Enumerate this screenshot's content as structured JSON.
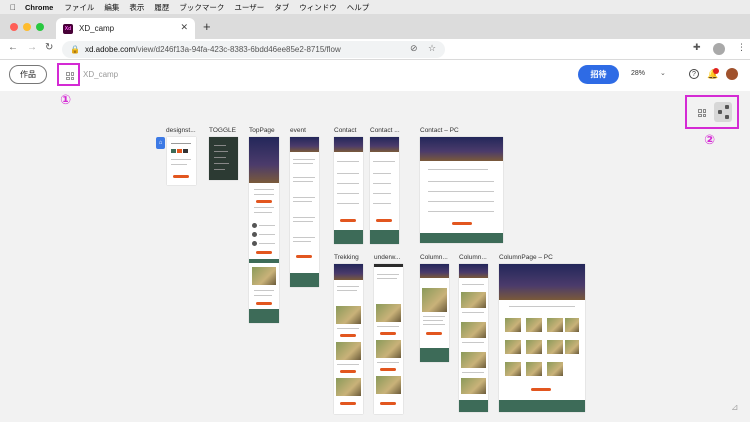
{
  "menubar": {
    "app": "Chrome",
    "items": [
      "ファイル",
      "編集",
      "表示",
      "履歴",
      "ブックマーク",
      "ユーザー",
      "タブ",
      "ウィンドウ",
      "ヘルプ"
    ]
  },
  "browser": {
    "tab_title": "XD_camp",
    "url_host": "xd.adobe.com",
    "url_path": "/view/d246f13a-94fa-423c-8383-6bdd46ee85e2-8715/flow"
  },
  "app": {
    "works_label": "作品",
    "doc_name": "XD_camp",
    "invite_label": "招待",
    "zoom": "28%"
  },
  "annotations": {
    "marker1": "①",
    "marker2": "②"
  },
  "artboards": [
    {
      "name": "designst..."
    },
    {
      "name": "TOGGLE"
    },
    {
      "name": "TopPage"
    },
    {
      "name": "event"
    },
    {
      "name": "Contact"
    },
    {
      "name": "Contact ..."
    },
    {
      "name": "Contact – PC"
    },
    {
      "name": "Trekking"
    },
    {
      "name": "underw..."
    },
    {
      "name": "Column..."
    },
    {
      "name": "Column..."
    },
    {
      "name": "ColumnPage – PC"
    }
  ],
  "colors": {
    "accent": "#d42ad4",
    "invite": "#2e6be5",
    "footer_green": "#3d6b58",
    "cta_orange": "#e2561f"
  }
}
